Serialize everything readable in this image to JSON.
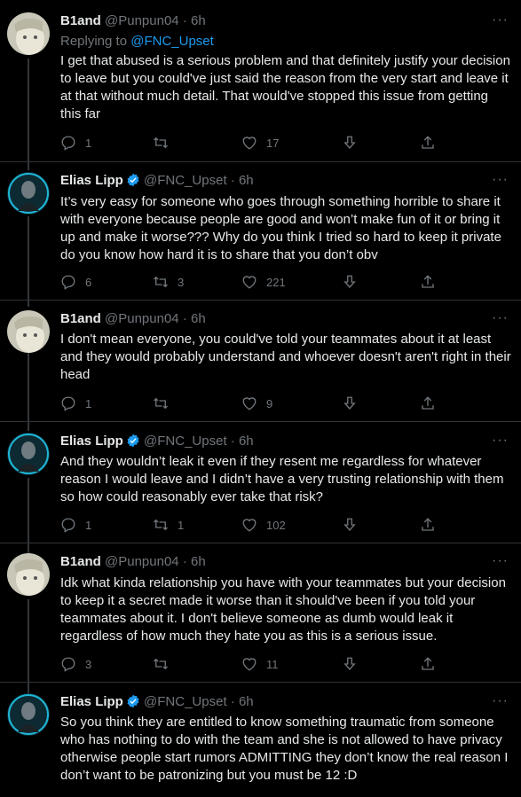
{
  "tweets": [
    {
      "author": "B1and",
      "handle": "@Punpun04",
      "time": "· 6h",
      "replying_prefix": "Replying to ",
      "replying_to": "@FNC_Upset",
      "text": "I get that abused is a serious problem and that definitely justify your decision to leave but you could've just said the reason from the very start and leave it at that without much detail. That would've stopped this issue from getting this far",
      "replies": "1",
      "retweets": "",
      "likes": "17"
    },
    {
      "author": "Elias Lipp",
      "handle": "@FNC_Upset",
      "time": "· 6h",
      "verified": true,
      "text": "It’s very easy for someone who goes through something horrible to share it with everyone because people are good and won’t make fun of it or bring it up and make it worse??? Why do you think I tried so hard to keep it private do you know how hard it is to share that you don’t obv",
      "replies": "6",
      "retweets": "3",
      "likes": "221"
    },
    {
      "author": "B1and",
      "handle": "@Punpun04",
      "time": "· 6h",
      "text": "I don't mean everyone, you could've told your teammates about it at least and they would probably understand and whoever doesn't aren't right in their head",
      "replies": "1",
      "retweets": "",
      "likes": "9"
    },
    {
      "author": "Elias Lipp",
      "handle": "@FNC_Upset",
      "time": "· 6h",
      "verified": true,
      "text": "And they wouldn’t leak it even if they resent me regardless for whatever reason I would leave and I didn’t have a very trusting relationship with them so how could reasonably ever take that risk?",
      "replies": "1",
      "retweets": "1",
      "likes": "102"
    },
    {
      "author": "B1and",
      "handle": "@Punpun04",
      "time": "· 6h",
      "text": "Idk what kinda relationship you have with your teammates but your decision to keep it a secret made it worse than it should've been if you told your teammates about it. I don't believe someone as dumb would leak it regardless of how much they hate you as this is a serious issue.",
      "replies": "3",
      "retweets": "",
      "likes": "11"
    },
    {
      "author": "Elias Lipp",
      "handle": "@FNC_Upset",
      "time": "· 6h",
      "verified": true,
      "text": "So you think they are entitled to know something traumatic from someone who has nothing to do with the team and she is not allowed to have privacy otherwise people start rumors ADMITTING they don’t know the real reason I don’t want to be patronizing but you must be 12 :D"
    }
  ],
  "more_glyph": "···",
  "colors": {
    "background": "#000000",
    "text": "#e7e9ea",
    "muted": "#71767b",
    "link": "#1d9bf0",
    "verified": "#1d9bf0"
  }
}
